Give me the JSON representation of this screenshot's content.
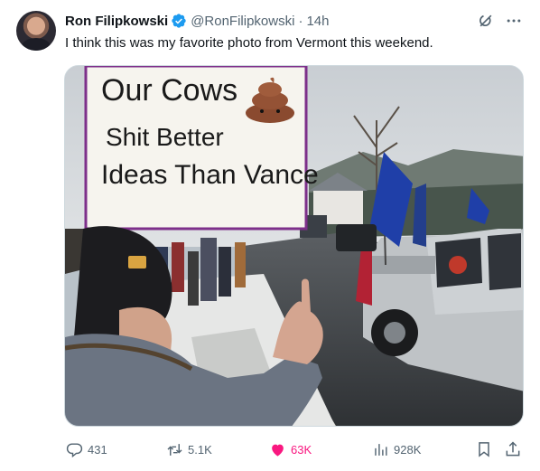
{
  "author": {
    "name": "Ron Filipkowski",
    "handle": "@RonFilipkowski",
    "separator": "·",
    "time": "14h"
  },
  "post": {
    "text": "I think this was my favorite photo from Vermont this weekend."
  },
  "media": {
    "sign_lines": [
      "Our Cows",
      "Shit Better",
      "Ideas Than Vance"
    ]
  },
  "actions": {
    "replies": "431",
    "reposts": "5.1K",
    "likes": "63K",
    "views": "928K"
  },
  "colors": {
    "like_active": "#f91880",
    "verified": "#1d9bf0",
    "muted_text": "#536471"
  },
  "icons": [
    "verified-badge-icon",
    "grok-icon",
    "more-icon",
    "reply-icon",
    "repost-icon",
    "like-icon",
    "views-icon",
    "bookmark-icon",
    "share-icon"
  ]
}
